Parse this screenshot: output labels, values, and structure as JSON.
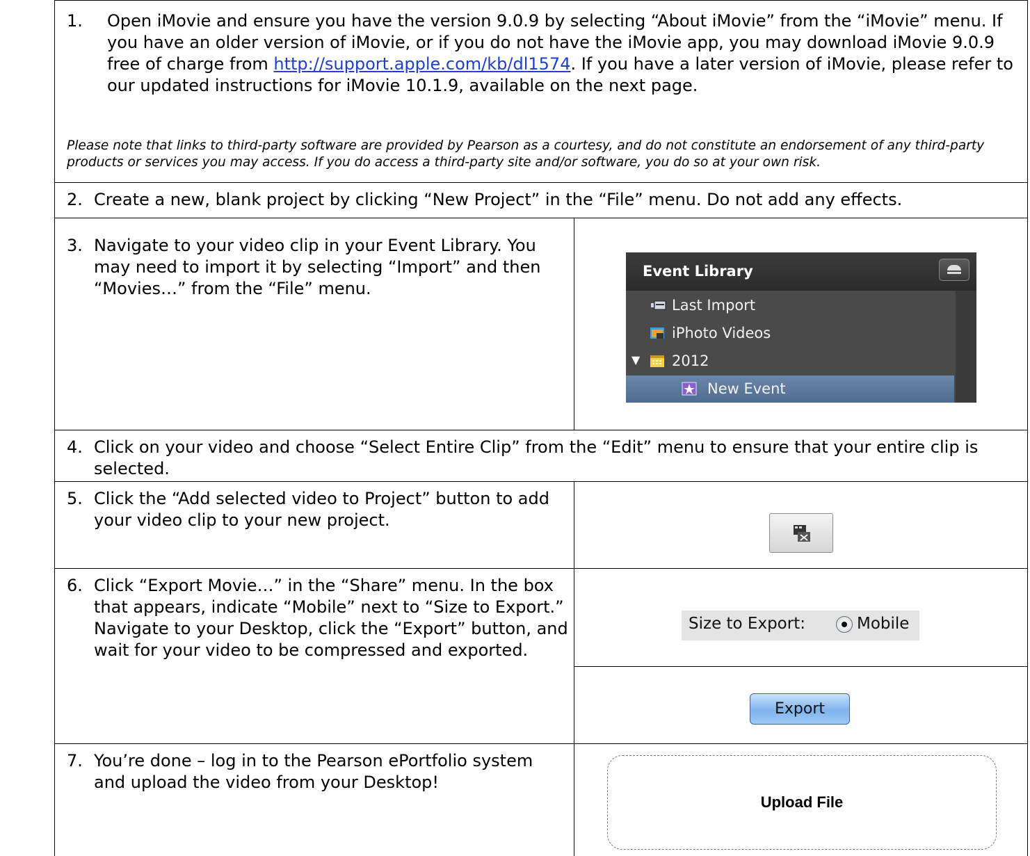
{
  "steps": [
    {
      "num": "1.",
      "text_before_link": "Open iMovie and ensure you have the version 9.0.9 by selecting “About iMovie” from the “iMovie” menu. If you have an older version of iMovie, or if you do not have the iMovie app, you may download iMovie 9.0.9 free of charge from",
      "link": "http://support.apple.com/kb/dl1574",
      "text_after_link": ". If you have a later version of iMovie, please refer to our updated instructions for iMovie 10.1.9, available on the next page.",
      "note": "Please note that links to third-party software are provided by Pearson as a courtesy, and do not constitute an endorsement of any third-party products or services you may access. If you do access a third-party site and/or software, you do so at your own risk."
    },
    {
      "num": "2.",
      "text": "Create a new, blank project by clicking “New Project” in the “File” menu. Do not add any effects."
    },
    {
      "num": "3.",
      "text": "Navigate to your video clip in your Event Library. You may need to import it by selecting “Import” and then “Movies…” from the “File” menu."
    },
    {
      "num": "4.",
      "text": "Click on your video and choose “Select Entire Clip” from the “Edit” menu to ensure that your entire clip is selected."
    },
    {
      "num": "5.",
      "text": "Click the “Add selected video to Project” button to add your video clip to your new project."
    },
    {
      "num": "6.",
      "text": "Click “Export Movie…” in the “Share” menu.  In the box that appears, indicate “Mobile” next to “Size to Export.” Navigate to your Desktop, click the “Export” button, and wait for your video to be compressed and exported."
    },
    {
      "num": "7.",
      "text": "You’re done – log in to the Pearson ePortfolio system and upload the video from your Desktop!"
    }
  ],
  "event_library": {
    "title": "Event Library",
    "items": [
      "Last Import",
      "iPhoto Videos",
      "2012",
      "New Event"
    ]
  },
  "size_export": {
    "label": "Size to Export:",
    "option": "Mobile"
  },
  "export_button": "Export",
  "upload_button": "Upload File"
}
